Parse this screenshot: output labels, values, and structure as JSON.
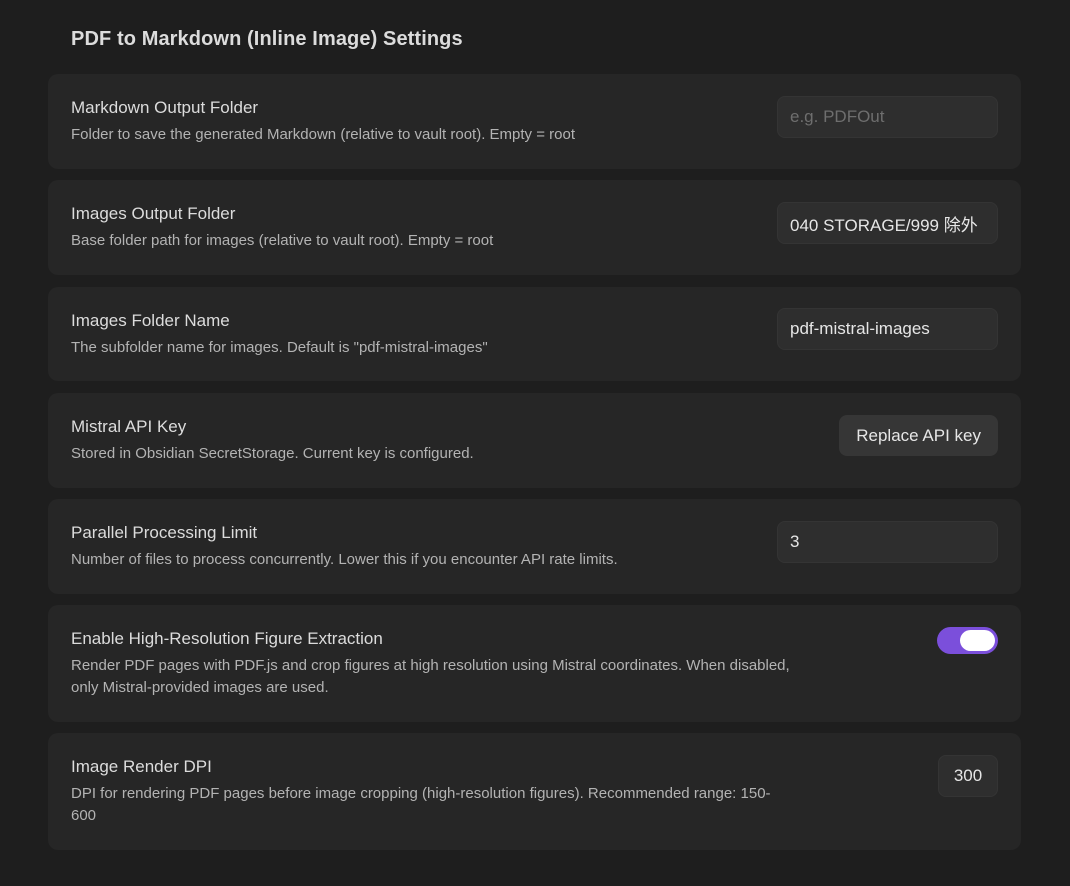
{
  "header": {
    "title": "PDF to Markdown (Inline Image) Settings"
  },
  "settings": {
    "markdown_output_folder": {
      "name": "Markdown Output Folder",
      "description": "Folder to save the generated Markdown (relative to vault root). Empty = root",
      "value": "",
      "placeholder": "e.g. PDFOut"
    },
    "images_output_folder": {
      "name": "Images Output Folder",
      "description": "Base folder path for images (relative to vault root). Empty = root",
      "value": "040 STORAGE/999 除外"
    },
    "images_folder_name": {
      "name": "Images Folder Name",
      "description": "The subfolder name for images. Default is \"pdf-mistral-images\"",
      "value": "pdf-mistral-images"
    },
    "mistral_api_key": {
      "name": "Mistral API Key",
      "description": "Stored in Obsidian SecretStorage. Current key is configured.",
      "button_label": "Replace API key"
    },
    "parallel_processing_limit": {
      "name": "Parallel Processing Limit",
      "description": "Number of files to process concurrently. Lower this if you encounter API rate limits.",
      "value": "3"
    },
    "high_resolution_extraction": {
      "name": "Enable High-Resolution Figure Extraction",
      "description_line1": "Render PDF pages with PDF.js and crop figures at high resolution using Mistral coordinates. When disabled,",
      "description_line2": "only Mistral-provided images are used.",
      "enabled": true
    },
    "image_render_dpi": {
      "name": "Image Render DPI",
      "description_line1": "DPI for rendering PDF pages before image cropping (high-resolution figures). Recommended range: 150-",
      "description_line2": "600",
      "value": "300"
    }
  },
  "colors": {
    "background": "#1e1e1e",
    "card": "#262626",
    "input": "#2e2e2e",
    "accent": "#7b4fdb"
  }
}
